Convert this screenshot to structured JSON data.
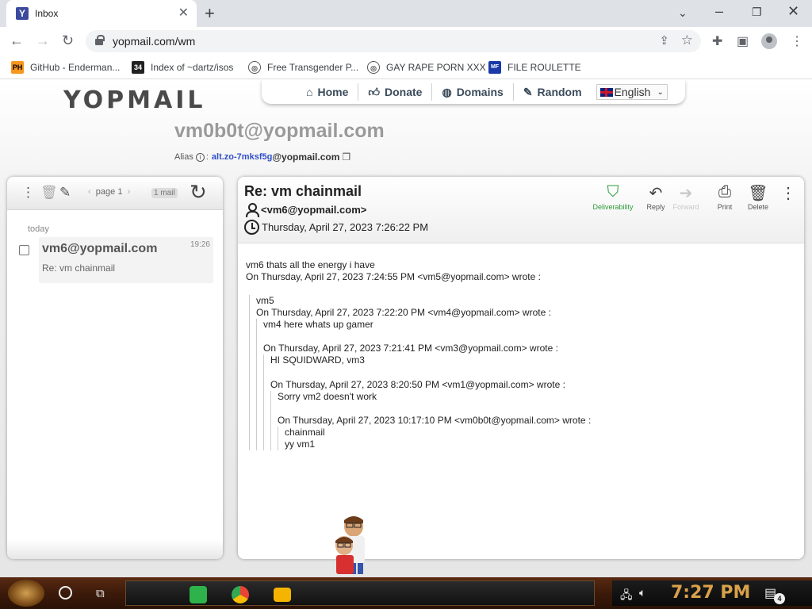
{
  "browser": {
    "tab_title": "Inbox",
    "url": "yopmail.com/wm",
    "bookmarks": [
      {
        "label": "GitHub - Enderman...",
        "icon": "ph-icon"
      },
      {
        "label": "Index of ~dartz/isos",
        "icon": "archive-icon"
      },
      {
        "label": "Free Transgender P...",
        "icon": "site-icon"
      },
      {
        "label": "GAY RAPE PORN XXX",
        "icon": "site-icon"
      },
      {
        "label": "FILE ROULETTE",
        "icon": "file-icon"
      }
    ]
  },
  "site": {
    "logo": "YOPMAIL",
    "nav": {
      "home": "Home",
      "donate": "Donate",
      "domains": "Domains",
      "random": "Random",
      "language": "English"
    },
    "address": "vm0b0t@yopmail.com",
    "alias": {
      "label": "Alias",
      "value": "alt.zo-7mksf5g",
      "domain": "@yopmail.com"
    }
  },
  "inbox": {
    "page_label": "page 1",
    "mail_count": "1 mail",
    "group_label": "today",
    "messages": [
      {
        "from": "vm6@yopmail.com",
        "subject": "Re: vm chainmail",
        "time": "19:26"
      }
    ]
  },
  "message": {
    "subject": "Re: vm chainmail",
    "from": "<vm6@yopmail.com>",
    "date": "Thursday, April 27, 2023 7:26:22 PM",
    "actions": {
      "deliverability": "Deliverability",
      "reply": "Reply",
      "forward": "Forward",
      "print": "Print",
      "delete": "Delete"
    },
    "body": {
      "l0a": "vm6 thats all the energy i have",
      "l0b": "On Thursday, April 27, 2023 7:24:55 PM <vm5@yopmail.com> wrote :",
      "l1a": "vm5",
      "l1b": "On Thursday, April 27, 2023 7:22:20 PM <vm4@yopmail.com> wrote :",
      "l2a": "vm4 here whats up gamer",
      "l2b": "On Thursday, April 27, 2023 7:21:41 PM <vm3@yopmail.com> wrote :",
      "l3a": "HI SQUIDWARD, vm3",
      "l3b": "On Thursday, April 27, 2023 8:20:50 PM <vm1@yopmail.com> wrote :",
      "l4a": "Sorry vm2 doesn't work",
      "l4b": "On Thursday, April 27, 2023 10:17:10 PM <vm0b0t@yopmail.com> wrote :",
      "l5a": "chainmail",
      "l5b": "yy vm1"
    }
  },
  "taskbar": {
    "clock": "7:27 PM",
    "notification_count": "4"
  }
}
